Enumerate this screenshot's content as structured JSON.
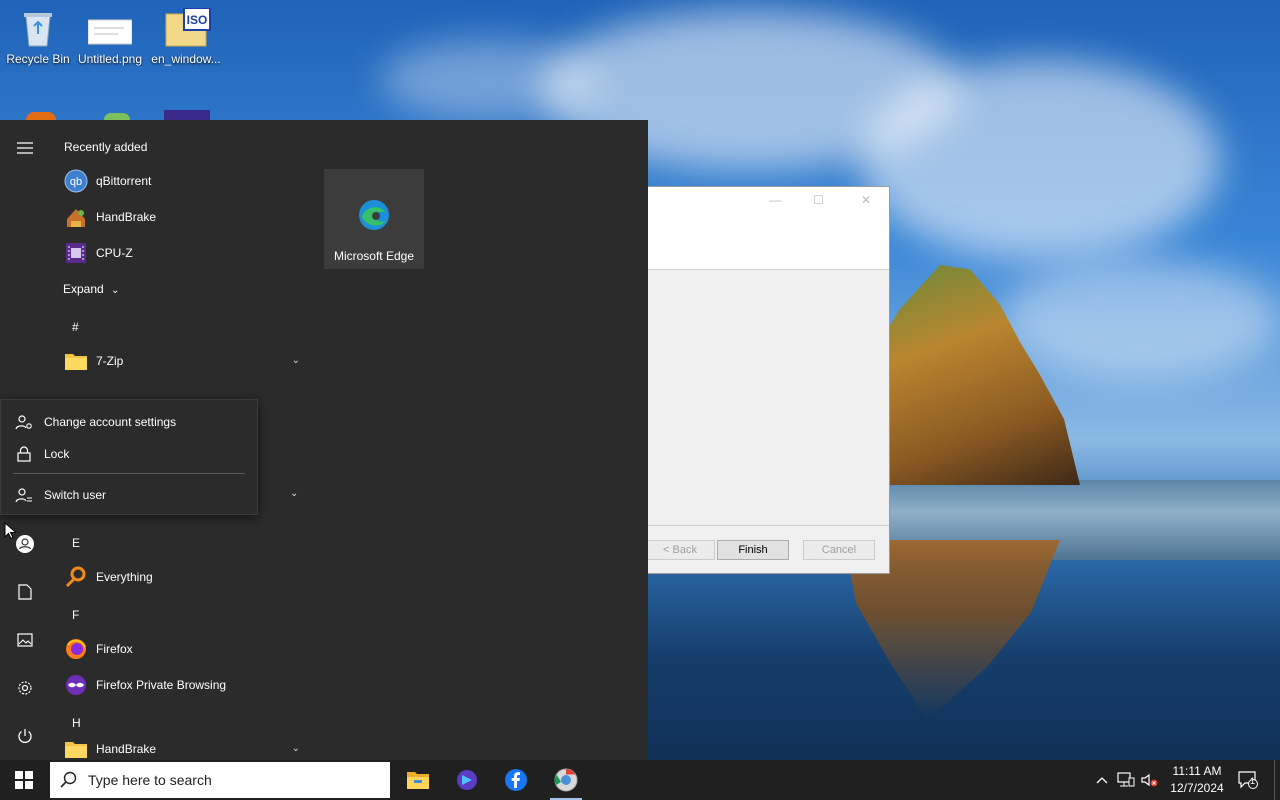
{
  "desktop": {
    "icons": [
      {
        "label": "Recycle Bin",
        "icon": "recycle-bin-icon"
      },
      {
        "label": "Untitled.png",
        "icon": "image-file-icon"
      },
      {
        "label": "en_window...",
        "icon": "iso-file-icon"
      }
    ]
  },
  "dialog": {
    "buttons": {
      "back": "< Back",
      "finish": "Finish",
      "cancel": "Cancel"
    }
  },
  "start_menu": {
    "recently_added_label": "Recently added",
    "recent_apps": [
      {
        "name": "qBittorrent",
        "icon": "qbittorrent-icon"
      },
      {
        "name": "HandBrake",
        "icon": "handbrake-icon"
      },
      {
        "name": "CPU-Z",
        "icon": "cpuz-icon"
      }
    ],
    "expand_label": "Expand",
    "groups": {
      "hash": "#",
      "e": "E",
      "f": "F",
      "h": "H"
    },
    "apps": {
      "seven_zip": "7-Zip",
      "everything": "Everything",
      "firefox": "Firefox",
      "firefox_private": "Firefox Private Browsing",
      "handbrake_folder": "HandBrake"
    },
    "tile": {
      "name": "Microsoft Edge",
      "icon": "edge-icon"
    },
    "account_menu": {
      "change_settings": "Change account settings",
      "lock": "Lock",
      "switch_user": "Switch user"
    }
  },
  "taskbar": {
    "search_placeholder": "Type here to search",
    "pinned": [
      "file-explorer-icon",
      "copilot-icon",
      "facebook-icon",
      "chrome-icon"
    ],
    "clock": {
      "time": "11:11 AM",
      "date": "12/7/2024"
    },
    "notification_count": "1"
  }
}
